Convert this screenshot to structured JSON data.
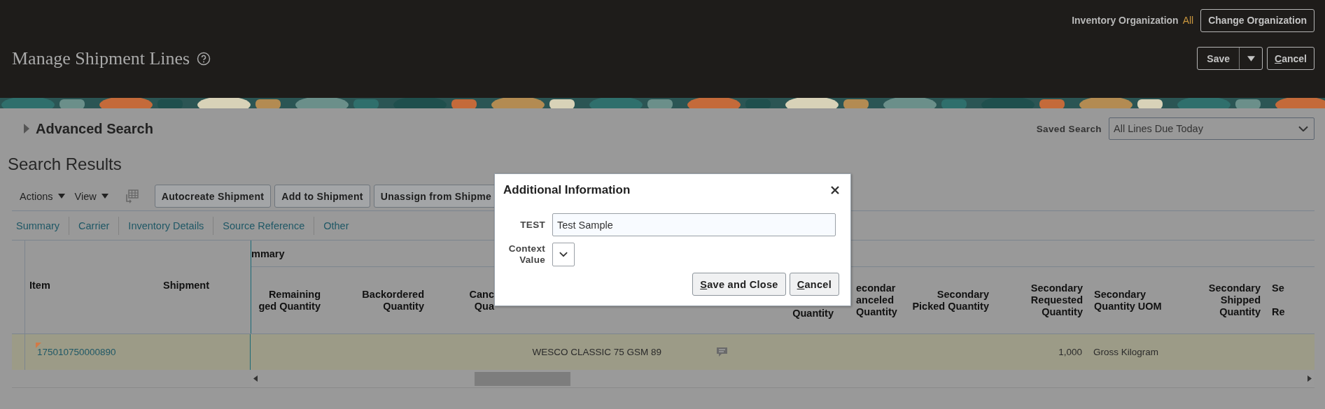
{
  "header": {
    "org_label": "Inventory Organization",
    "org_value": "All",
    "change_org": "Change Organization",
    "title": "Manage Shipment Lines",
    "save": "Save",
    "cancel": "Cancel"
  },
  "search": {
    "advanced": "Advanced Search",
    "expanded": false,
    "saved_label": "Saved Search",
    "saved_value": "All Lines Due Today"
  },
  "results": {
    "title": "Search Results",
    "menus": [
      "Actions",
      "View"
    ],
    "buttons": [
      "Autocreate Shipment",
      "Add to Shipment",
      "Unassign from Shipme"
    ],
    "tabs": [
      "Summary",
      "Carrier",
      "Inventory Details",
      "Source Reference",
      "Other"
    ]
  },
  "table": {
    "frozen_columns": [
      "Item",
      "Shipment"
    ],
    "group": "mmary",
    "columns": [
      {
        "kind": "text",
        "header": [
          "Remaining",
          "ged Quantity"
        ]
      },
      {
        "kind": "text",
        "header": [
          "Backordered",
          "Quantity"
        ]
      },
      {
        "kind": "text",
        "header": [
          "Canc",
          "Qua"
        ]
      },
      {
        "kind": "text",
        "cells": [
          "WESCO CLASSIC 75 GSM 89"
        ]
      },
      {
        "kind": "icon"
      },
      {
        "kind": "text",
        "header": [
          "Quantity"
        ]
      },
      {
        "kind": "text",
        "header": [
          "econdar",
          "anceled",
          "Quantity"
        ]
      },
      {
        "kind": "text",
        "header": [
          "Secondary",
          "Picked Quantity"
        ]
      },
      {
        "kind": "text",
        "header": [
          "Secondary",
          "Requested",
          "Quantity"
        ],
        "cells": [
          "1,000"
        ]
      },
      {
        "kind": "text",
        "header": [
          "Secondary",
          "Quantity UOM"
        ],
        "cells": [
          "Gross Kilogram"
        ]
      },
      {
        "kind": "text",
        "header": [
          "Secondary",
          "Shipped",
          "Quantity"
        ]
      },
      {
        "kind": "text",
        "header": [
          "Se",
          "Re"
        ]
      }
    ],
    "rows": [
      {
        "item": "175010750000890",
        "flagged": true,
        "selected": true
      }
    ]
  },
  "dialog": {
    "title": "Additional Information",
    "fields": [
      {
        "label": "TEST",
        "kind": "text",
        "value": "Test Sample"
      },
      {
        "label": "Context Value",
        "kind": "select"
      }
    ],
    "buttons": [
      "Save and Close",
      "Cancel"
    ]
  }
}
